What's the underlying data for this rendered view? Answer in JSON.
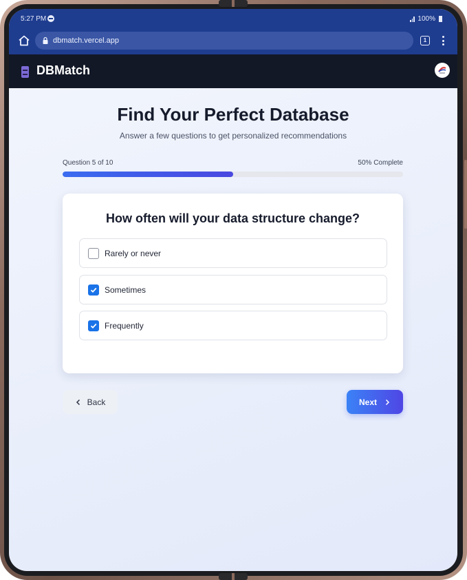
{
  "status_bar": {
    "time": "5:27 PM",
    "battery": "100%"
  },
  "browser": {
    "url": "dbmatch.vercel.app",
    "tab_count": "1"
  },
  "app": {
    "title": "DBMatch"
  },
  "page": {
    "title": "Find Your Perfect Database",
    "subtitle": "Answer a few questions to get personalized recommendations"
  },
  "progress": {
    "question_label": "Question 5 of 10",
    "complete_label": "50% Complete",
    "fraction": 0.5
  },
  "question": {
    "text": "How often will your data structure change?",
    "options": [
      {
        "label": "Rarely or never",
        "checked": false
      },
      {
        "label": "Sometimes",
        "checked": true
      },
      {
        "label": "Frequently",
        "checked": true
      }
    ]
  },
  "nav": {
    "back_label": "Back",
    "next_label": "Next"
  },
  "colors": {
    "browser_bar": "#1f3d8f",
    "app_header": "#121826",
    "accent": "#3b82f6",
    "checkbox": "#1a73e8"
  }
}
